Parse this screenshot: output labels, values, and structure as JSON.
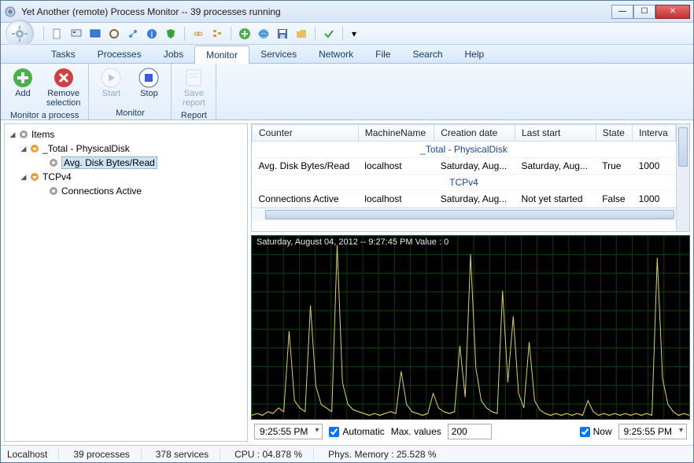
{
  "window": {
    "title": "Yet Another (remote) Process Monitor -- 39 processes running"
  },
  "menu": {
    "items": [
      "Tasks",
      "Processes",
      "Jobs",
      "Monitor",
      "Services",
      "Network",
      "File",
      "Search",
      "Help"
    ],
    "active_index": 3
  },
  "ribbon": {
    "groups": [
      {
        "label": "Monitor a process",
        "buttons": [
          {
            "label": "Add",
            "key": "add",
            "enabled": true
          },
          {
            "label": "Remove selection",
            "key": "remove",
            "enabled": true
          }
        ]
      },
      {
        "label": "Monitor",
        "buttons": [
          {
            "label": "Start",
            "key": "start",
            "enabled": false
          },
          {
            "label": "Stop",
            "key": "stop",
            "enabled": true
          }
        ]
      },
      {
        "label": "Report",
        "buttons": [
          {
            "label": "Save report",
            "key": "savereport",
            "enabled": false
          }
        ]
      }
    ]
  },
  "tree": {
    "root": "Items",
    "nodes": [
      {
        "label": "_Total - PhysicalDisk",
        "expanded": true,
        "children": [
          {
            "label": "Avg. Disk Bytes/Read",
            "selected": true
          }
        ]
      },
      {
        "label": "TCPv4",
        "expanded": true,
        "children": [
          {
            "label": "Connections Active",
            "selected": false
          }
        ]
      }
    ]
  },
  "table": {
    "columns": [
      "Counter",
      "MachineName",
      "Creation date",
      "Last start",
      "State",
      "Interva"
    ],
    "groups": [
      {
        "title": "_Total - PhysicalDisk",
        "rows": [
          {
            "Counter": "Avg. Disk Bytes/Read",
            "MachineName": "localhost",
            "Creation date": "Saturday, Aug...",
            "Last start": "Saturday, Aug...",
            "State": "True",
            "Interva": "1000"
          }
        ]
      },
      {
        "title": "TCPv4",
        "rows": [
          {
            "Counter": "Connections Active",
            "MachineName": "localhost",
            "Creation date": "Saturday, Aug...",
            "Last start": "Not yet started",
            "State": "False",
            "Interva": "1000"
          }
        ]
      }
    ]
  },
  "chart_data": {
    "type": "line",
    "title": "Saturday, August 04, 2012 -- 9:27:45 PM  Value : 0",
    "xlabel": "",
    "ylabel": "",
    "x_range_labels": [
      "9:25:55 PM",
      "9:25:55 PM"
    ],
    "ylim": [
      0,
      100
    ],
    "series": [
      {
        "name": "Avg. Disk Bytes/Read",
        "values": [
          2,
          3,
          2,
          4,
          3,
          6,
          4,
          48,
          10,
          6,
          4,
          62,
          18,
          8,
          6,
          4,
          95,
          20,
          8,
          5,
          4,
          3,
          2,
          3,
          2,
          3,
          4,
          3,
          26,
          8,
          4,
          3,
          2,
          3,
          14,
          6,
          4,
          3,
          4,
          40,
          12,
          90,
          28,
          10,
          6,
          4,
          3,
          70,
          20,
          56,
          14,
          6,
          42,
          10,
          5,
          3,
          2,
          3,
          2,
          3,
          2,
          3,
          2,
          10,
          4,
          2,
          3,
          2,
          3,
          2,
          3,
          2,
          3,
          2,
          3,
          2,
          88,
          22,
          8,
          4,
          2,
          3,
          2
        ]
      }
    ]
  },
  "chart_controls": {
    "left_time": "9:25:55 PM",
    "automatic_label": "Automatic",
    "automatic_checked": true,
    "max_values_label": "Max. values",
    "max_values": "200",
    "now_label": "Now",
    "now_checked": true,
    "right_time": "9:25:55 PM"
  },
  "statusbar": {
    "host": "Localhost",
    "processes": "39 processes",
    "services": "378 services",
    "cpu": "CPU : 04.878 %",
    "mem": "Phys. Memory : 25.528 %"
  }
}
